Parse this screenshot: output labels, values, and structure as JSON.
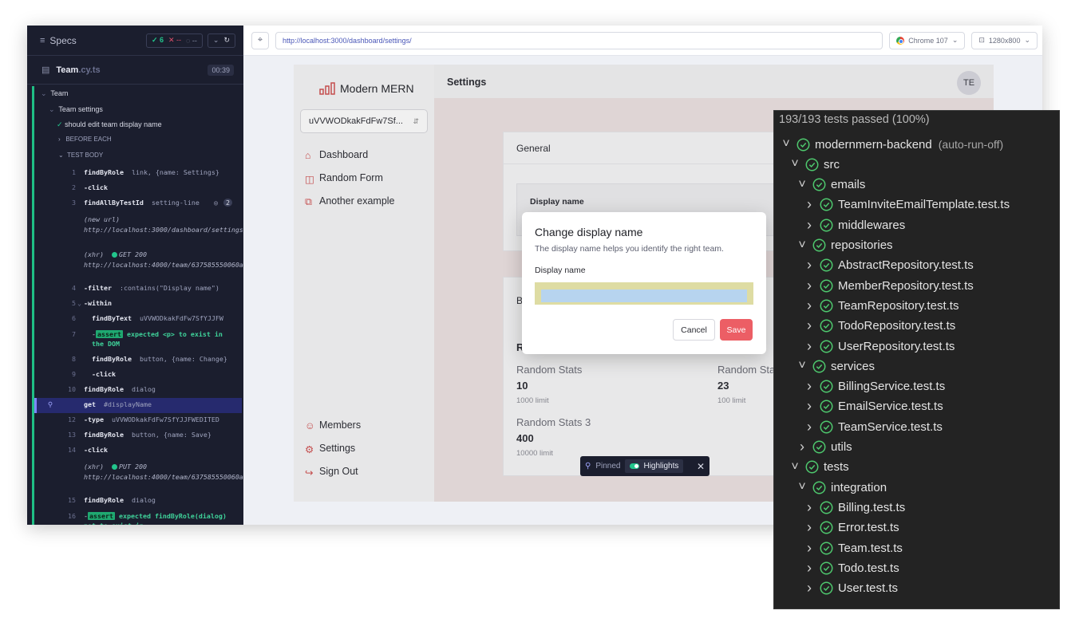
{
  "reporter": {
    "specs_label": "Specs",
    "passed": "6",
    "failed": "--",
    "pending": "--",
    "spec_file": "Team",
    "spec_ext": ".cy.ts",
    "duration": "00:39",
    "suite": "Team",
    "subsuite": "Team settings",
    "test": "should edit team display name",
    "before_each": "BEFORE EACH",
    "test_body": "TEST BODY",
    "commands": [
      {
        "num": "1",
        "name": "findByRole",
        "msg": "link, {name: Settings}"
      },
      {
        "num": "2",
        "name": "-click",
        "msg": ""
      },
      {
        "num": "3",
        "name": "findAllByTestId",
        "msg": "setting-line",
        "count": "2"
      },
      {
        "num": "",
        "name": "(new url)",
        "msg": "http://localhost:3000/dashboard/settings/"
      },
      {
        "num": "",
        "name": "(xhr)",
        "msg": "GET 200 http://localhost:4000/team/637585550060a8cd4c5ee8cb/settings"
      },
      {
        "num": "4",
        "name": "-filter",
        "msg": ":contains(\"Display name\")"
      },
      {
        "num": "5",
        "name": "-within",
        "msg": ""
      },
      {
        "num": "6",
        "name": "findByText",
        "msg": "uVVWODkakFdFw7SfYJJFW"
      },
      {
        "num": "7",
        "name": "-assert",
        "msg": "expected <p> to exist in the DOM"
      },
      {
        "num": "8",
        "name": "findByRole",
        "msg": "button, {name: Change}"
      },
      {
        "num": "9",
        "name": "-click",
        "msg": ""
      },
      {
        "num": "10",
        "name": "findByRole",
        "msg": "dialog"
      },
      {
        "num": "11",
        "name": "get",
        "msg": "#displayName"
      },
      {
        "num": "12",
        "name": "-type",
        "msg": "uVVWODkakFdFw7SfYJJFWEDITED"
      },
      {
        "num": "13",
        "name": "findByRole",
        "msg": "button, {name: Save}"
      },
      {
        "num": "14",
        "name": "-click",
        "msg": ""
      },
      {
        "num": "",
        "name": "(xhr)",
        "msg": "PUT 200 http://localhost:4000/team/637585550060a8cd4c5ee8cb/name"
      },
      {
        "num": "15",
        "name": "findByRole",
        "msg": "dialog"
      },
      {
        "num": "16",
        "name": "-assert",
        "msg": "expected findByRole(dialog) not to exist in"
      }
    ]
  },
  "aut": {
    "url": "http://localhost:3000/dashboard/settings/",
    "browser": "Chrome 107",
    "viewport": "1280x800"
  },
  "app": {
    "brand": "Modern MERN",
    "team_select": "uVVWODkakFdFw7Sf...",
    "nav": [
      "Dashboard",
      "Random Form",
      "Another example"
    ],
    "nav_bottom": [
      "Members",
      "Settings",
      "Sign Out"
    ],
    "page_title": "Settings",
    "avatar": "TE",
    "general_header": "General",
    "display_name_label": "Display name",
    "card2_letter": "B",
    "card3_letter": "R",
    "stats": [
      {
        "label": "Random Stats",
        "value": "10",
        "limit": "1000 limit"
      },
      {
        "label": "Random Sta",
        "value": "23",
        "limit": "100 limit"
      },
      {
        "label": "Random Stats 3",
        "value": "400",
        "limit": "10000 limit"
      }
    ]
  },
  "dialog": {
    "title": "Change display name",
    "description": "The display name helps you identify the right team.",
    "field_label": "Display name",
    "field_value": "",
    "cancel": "Cancel",
    "save": "Save"
  },
  "pinned": {
    "label": "Pinned",
    "highlights": "Highlights"
  },
  "vscode": {
    "summary": "193/193 tests passed (100%)",
    "items": [
      {
        "label": "modernmern-backend",
        "extra": "(auto-run-off)",
        "chev": "v"
      },
      {
        "label": "src",
        "chev": "v"
      },
      {
        "label": "emails",
        "chev": "v"
      },
      {
        "label": "TeamInviteEmailTemplate.test.ts",
        "chev": ">"
      },
      {
        "label": "middlewares",
        "chev": ">"
      },
      {
        "label": "repositories",
        "chev": "v"
      },
      {
        "label": "AbstractRepository.test.ts",
        "chev": ">"
      },
      {
        "label": "MemberRepository.test.ts",
        "chev": ">"
      },
      {
        "label": "TeamRepository.test.ts",
        "chev": ">"
      },
      {
        "label": "TodoRepository.test.ts",
        "chev": ">"
      },
      {
        "label": "UserRepository.test.ts",
        "chev": ">"
      },
      {
        "label": "services",
        "chev": "v"
      },
      {
        "label": "BillingService.test.ts",
        "chev": ">"
      },
      {
        "label": "EmailService.test.ts",
        "chev": ">"
      },
      {
        "label": "TeamService.test.ts",
        "chev": ">"
      },
      {
        "label": "utils",
        "chev": ">"
      },
      {
        "label": "tests",
        "chev": "v"
      },
      {
        "label": "integration",
        "chev": "v"
      },
      {
        "label": "Billing.test.ts",
        "chev": ">"
      },
      {
        "label": "Error.test.ts",
        "chev": ">"
      },
      {
        "label": "Team.test.ts",
        "chev": ">"
      },
      {
        "label": "Todo.test.ts",
        "chev": ">"
      },
      {
        "label": "User.test.ts",
        "chev": ">"
      }
    ]
  },
  "colors": {
    "pass": "#22c58c",
    "accent_red": "#ec5e65",
    "reporter_bg": "#1b1e2e"
  }
}
